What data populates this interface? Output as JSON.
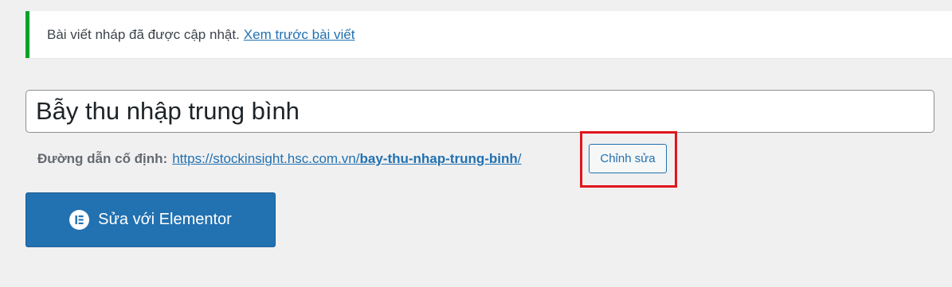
{
  "notice": {
    "message": "Bài viết nháp đã được cập nhật.",
    "link_label": "Xem trước bài viết",
    "accent_color": "#00a32a"
  },
  "title": {
    "value": "Bẫy thu nhập trung bình"
  },
  "permalink": {
    "label": "Đường dẫn cố định:",
    "base_url": "https://stockinsight.hsc.com.vn/",
    "slug": "bay-thu-nhap-trung-binh",
    "trailing": "/",
    "edit_button_label": "Chỉnh sửa",
    "highlight_color": "#e0161c"
  },
  "elementor": {
    "button_label": "Sửa với Elementor",
    "icon": "elementor-icon",
    "button_color": "#2271b1"
  }
}
